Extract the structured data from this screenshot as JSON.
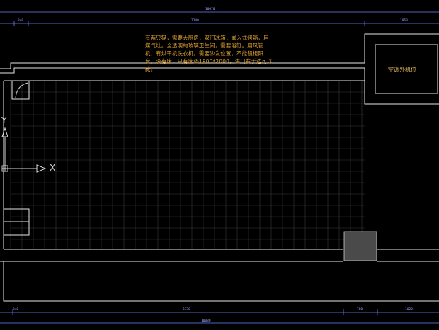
{
  "drawing": {
    "note_text": "有两只猫，需要大厨房，双门冰箱，嵌入式烤箱，用煤气灶。全透明的玻璃卫生间，需要浴缸。用风管机，有烘干机洗衣机。需要沙发位置。不能镜柜阳台。没有床，只有床垫1800*2000，进门右手边可以藏。",
    "ac_unit_label": "空调外机位",
    "dimensions": {
      "top_total": "10070",
      "top_left": "340",
      "top_middle": "7140",
      "top_right": "1860",
      "bottom_left": "340",
      "bottom_middle": "6730",
      "bottom_mid_right": "700",
      "bottom_right": "1620",
      "bottom_total": "10030"
    },
    "axis": {
      "y_label": "Y",
      "x_label": "X"
    },
    "colors": {
      "background": "#000000",
      "wall_line": "#e6e6e6",
      "grid_line": "#3a3a3a",
      "dimension_line": "#6f7fff",
      "note_text": "#e0a030",
      "block_fill": "#4a4a4a"
    }
  }
}
